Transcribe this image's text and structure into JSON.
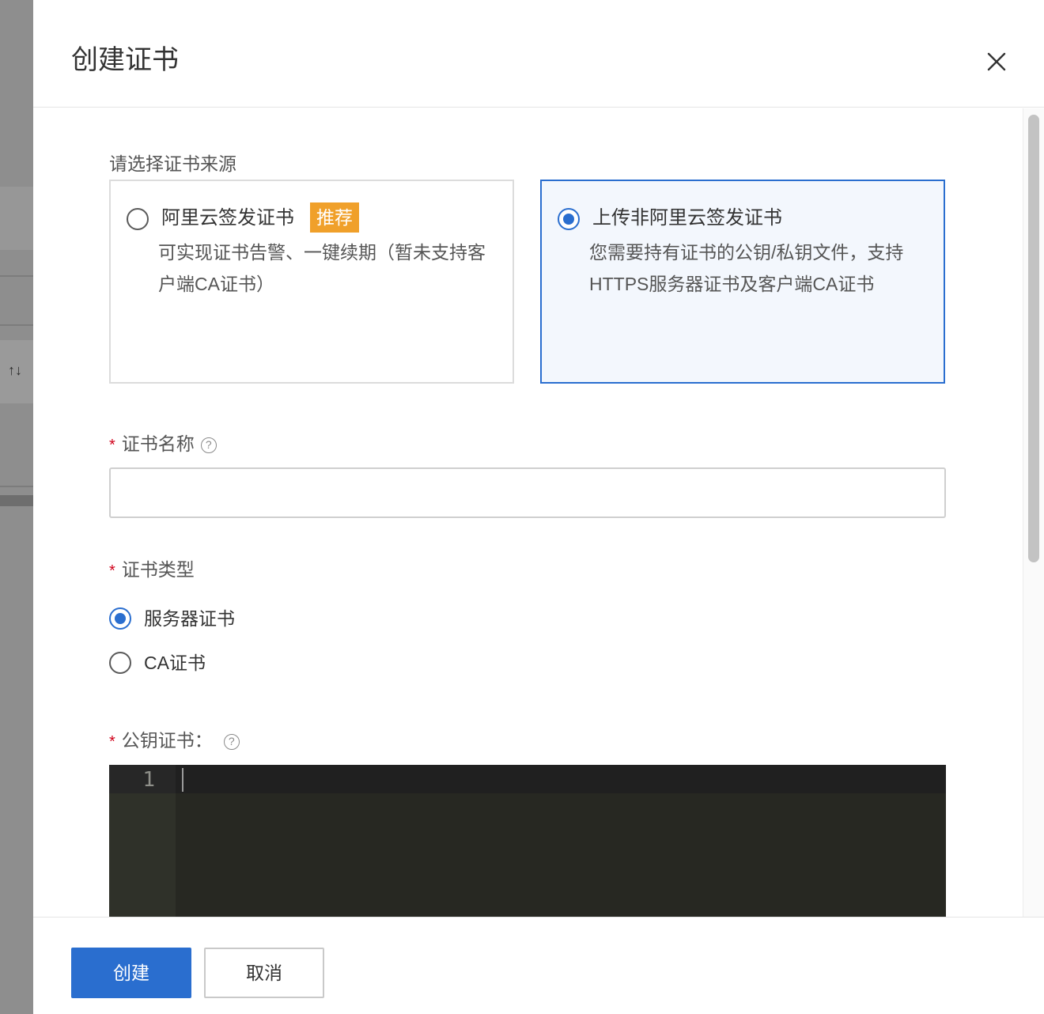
{
  "background": {
    "sort_glyph": "↑↓"
  },
  "drawer": {
    "title": "创建证书"
  },
  "source": {
    "label": "请选择证书来源",
    "options": [
      {
        "title": "阿里云签发证书",
        "badge": "推荐",
        "desc_line1": "可实现证书告警、一键续期（暂未支持客",
        "desc_line2": "户端CA证书）",
        "selected": false
      },
      {
        "title": "上传非阿里云签发证书",
        "desc_line1": "您需要持有证书的公钥/私钥文件，支持",
        "desc_line2": "HTTPS服务器证书及客户端CA证书",
        "selected": true
      }
    ]
  },
  "name_field": {
    "required_mark": "*",
    "label": "证书名称",
    "help": "?",
    "value": ""
  },
  "type_field": {
    "required_mark": "*",
    "label": "证书类型",
    "options": [
      {
        "label": "服务器证书",
        "selected": true
      },
      {
        "label": "CA证书",
        "selected": false
      }
    ]
  },
  "public_key_field": {
    "required_mark": "*",
    "label": "公钥证书：",
    "help": "?",
    "editor": {
      "line_number": "1",
      "content": ""
    }
  },
  "footer": {
    "create_label": "创建",
    "cancel_label": "取消"
  },
  "colors": {
    "primary": "#2a6ecf",
    "badge": "#f0a02a",
    "required": "#d0021b",
    "editor_bg": "#272822"
  }
}
